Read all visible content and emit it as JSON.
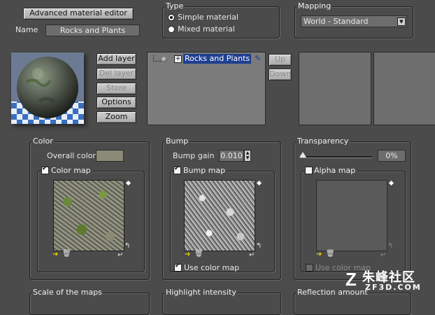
{
  "header": {
    "editor_button": "Advanced material editor",
    "name_label": "Name",
    "name_value": "Rocks and Plants"
  },
  "type": {
    "label": "Type",
    "options": [
      {
        "label": "Simple material",
        "selected": true
      },
      {
        "label": "Mixed material",
        "selected": false
      }
    ]
  },
  "mapping": {
    "label": "Mapping",
    "selected": "World - Standard"
  },
  "layers": {
    "buttons": [
      "Add layer",
      "Del layer",
      "Store",
      "Options",
      "Zoom"
    ],
    "enabled": [
      true,
      false,
      false,
      true,
      true
    ],
    "tree_item": "Rocks and Plants",
    "up_label": "Up",
    "down_label": "Down"
  },
  "color": {
    "label": "Color",
    "overall_label": "Overall color:",
    "overall_color": "#8a8a78",
    "map_label": "Color map",
    "map_checked": true
  },
  "bump": {
    "label": "Bump",
    "gain_label": "Bump gain",
    "gain_value": "0.010",
    "map_label": "Bump map",
    "map_checked": true,
    "use_color_map_label": "Use color map",
    "use_color_map_checked": true
  },
  "transparency": {
    "label": "Transparency",
    "value": "0%",
    "slider_fraction": 0.0,
    "alpha_label": "Alpha map",
    "alpha_checked": false,
    "use_color_map_label": "Use color map",
    "use_color_map_enabled": false
  },
  "bottom": {
    "scale_label": "Scale of the maps",
    "highlight_label": "Highlight intensity",
    "reflection_label": "Reflection amount"
  },
  "watermark": {
    "text": "朱峰社区",
    "sub": "ZF3D.COM"
  },
  "colors": {
    "panel_bg": "#4b4b4b",
    "selection": "#1f3f8f"
  }
}
